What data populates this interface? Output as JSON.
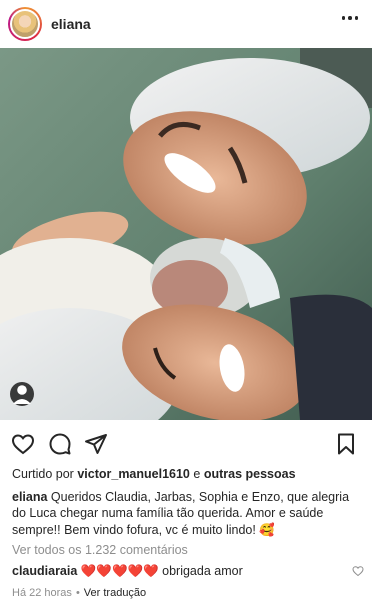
{
  "header": {
    "username": "eliana",
    "more_icon": "more-horizontal-icon"
  },
  "photo": {
    "tag_icon": "user-tag-icon"
  },
  "actions": {
    "like_icon": "heart-icon",
    "comment_icon": "comment-icon",
    "share_icon": "send-icon",
    "save_icon": "bookmark-icon"
  },
  "likes": {
    "prefix": "Curtido por",
    "user": "victor_manuel1610",
    "connector": "e",
    "others": "outras pessoas"
  },
  "caption": {
    "username": "eliana",
    "text": "Queridos Claudia, Jarbas, Sophia e Enzo, que alegria do Luca chegar numa família tão querida. Amor e saúde sempre!! Bem vindo fofura, vc é muito lindo! 🥰"
  },
  "view_comments": "Ver todos os 1.232 comentários",
  "comment": {
    "username": "claudiaraia",
    "hearts": "❤️❤️❤️❤️❤️",
    "text": "obrigada amor"
  },
  "meta": {
    "time": "Há 22 horas",
    "separator": "•",
    "translation": "Ver tradução"
  },
  "colors": {
    "text": "#262626",
    "muted": "#8e8e8e",
    "heart_red": "#ed4956"
  }
}
